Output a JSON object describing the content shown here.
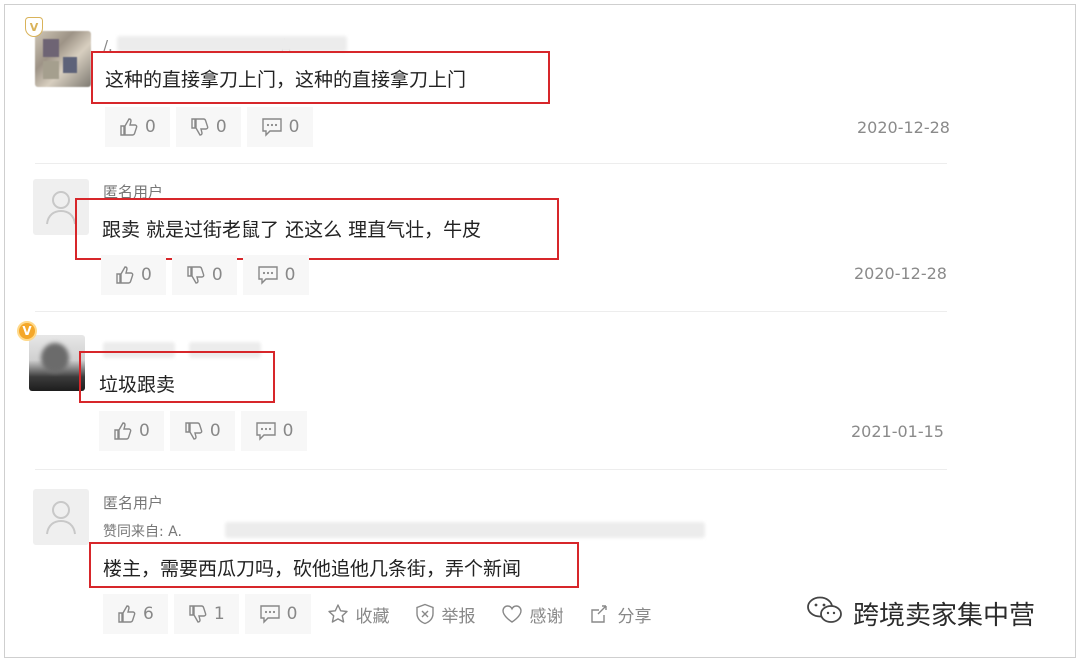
{
  "comments": [
    {
      "name": "/.　　　　　　　　　　　者",
      "text": "这种的直接拿刀上门，这种的直接拿刀上门",
      "likes": "0",
      "dislikes": "0",
      "replies": "0",
      "date": "2020-12-28",
      "vip_badge": "V"
    },
    {
      "name": "匿名用户",
      "text": "跟卖 就是过街老鼠了 还这么 理直气壮，牛皮",
      "likes": "0",
      "dislikes": "0",
      "replies": "0",
      "date": "2020-12-28"
    },
    {
      "name": "",
      "text": "垃圾跟卖",
      "likes": "0",
      "dislikes": "0",
      "replies": "0",
      "date": "2021-01-15",
      "vip_badge": "V"
    },
    {
      "name": "匿名用户",
      "sub": "赞同来自: A.",
      "text": "楼主，需要西瓜刀吗，砍他追他几条街，弄个新闻",
      "likes": "6",
      "dislikes": "1",
      "replies": "0",
      "collect": "收藏",
      "report": "举报",
      "thank": "感谢",
      "share": "分享"
    }
  ],
  "watermark": "跨境卖家集中营",
  "colors": {
    "highlight": "#d7262a",
    "vip": "#f4a72a"
  },
  "icons": [
    "thumbs-up-icon",
    "thumbs-down-icon",
    "comment-icon",
    "star-icon",
    "report-shield-icon",
    "heart-icon",
    "share-icon",
    "wechat-icon",
    "user-placeholder-icon"
  ]
}
